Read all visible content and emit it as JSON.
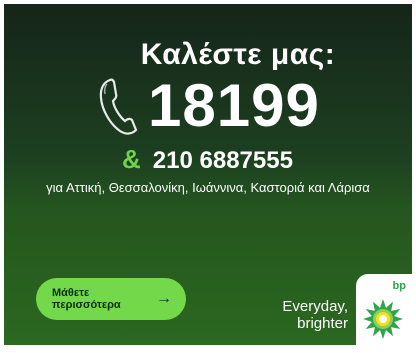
{
  "headline": "Καλέστε μας:",
  "phone": {
    "primary_number": "18199",
    "ampersand": "&",
    "secondary_number": "210 6887555"
  },
  "coverage_text": "για Αττική, Θεσσαλονίκη, Ιωάννινα, Καστοριά και Λάρισα",
  "cta": {
    "label": "Μάθετε περισσότερα",
    "arrow": "→"
  },
  "tagline": "Everyday, brighter",
  "logo": {
    "text": "bp",
    "icon": "bp-helios-logo"
  },
  "colors": {
    "accent_green": "#74d94a",
    "dark_green": "#15251a",
    "mid_green": "#2a6a22",
    "bp_green": "#2ea44f",
    "bp_yellow": "#f5e11a"
  }
}
